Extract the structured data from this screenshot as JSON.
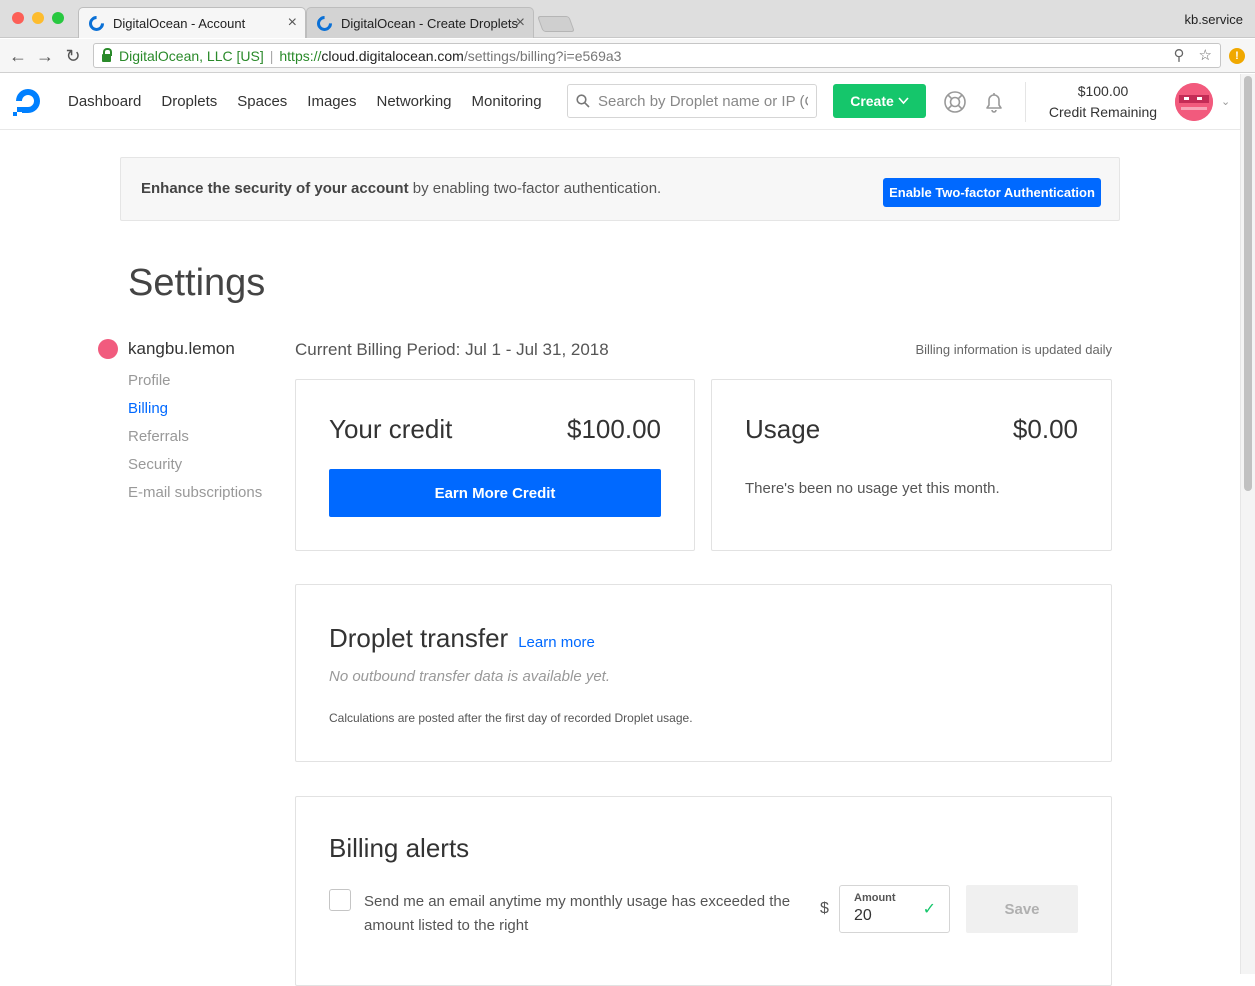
{
  "browser": {
    "tabs": [
      {
        "title": "DigitalOcean - Account",
        "close": "×"
      },
      {
        "title": "DigitalOcean - Create Droplets",
        "close": "×"
      }
    ],
    "profile": "kb.service",
    "cert_owner": "DigitalOcean, LLC [US]",
    "url_scheme": "https://",
    "url_host": "cloud.digitalocean.com",
    "url_path": "/settings/billing?i=e569a3",
    "warning_badge": "!"
  },
  "header": {
    "nav": [
      "Dashboard",
      "Droplets",
      "Spaces",
      "Images",
      "Networking",
      "Monitoring"
    ],
    "search_placeholder": "Search by Droplet name or IP (Cmd+B)",
    "create_label": "Create",
    "credit_amount": "$100.00",
    "credit_label": "Credit Remaining",
    "accent": "#0069ff",
    "create_color": "#15c66b"
  },
  "banner": {
    "bold": "Enhance the security of your account",
    "rest": " by enabling two-factor authentication.",
    "button": "Enable Two-factor Authentication"
  },
  "settings": {
    "title": "Settings",
    "username": "kangbu.lemon",
    "nav": [
      {
        "label": "Profile"
      },
      {
        "label": "Billing"
      },
      {
        "label": "Referrals"
      },
      {
        "label": "Security"
      },
      {
        "label": "E-mail subscriptions"
      }
    ]
  },
  "billing": {
    "period": "Current Billing Period: Jul 1 - Jul 31, 2018",
    "updated": "Billing information is updated daily",
    "credit_title": "Your credit",
    "credit_amount": "$100.00",
    "earn_button": "Earn More Credit",
    "usage_title": "Usage",
    "usage_amount": "$0.00",
    "usage_note": "There's been no usage yet this month."
  },
  "transfer": {
    "title": "Droplet transfer",
    "learn_more": "Learn more",
    "empty": "No outbound transfer data is available yet.",
    "note": "Calculations are posted after the first day of recorded Droplet usage."
  },
  "alerts": {
    "title": "Billing alerts",
    "text": "Send me an email anytime my monthly usage has exceeded the amount listed to the right",
    "currency": "$",
    "amount_label": "Amount",
    "amount_value": "20",
    "save": "Save"
  }
}
